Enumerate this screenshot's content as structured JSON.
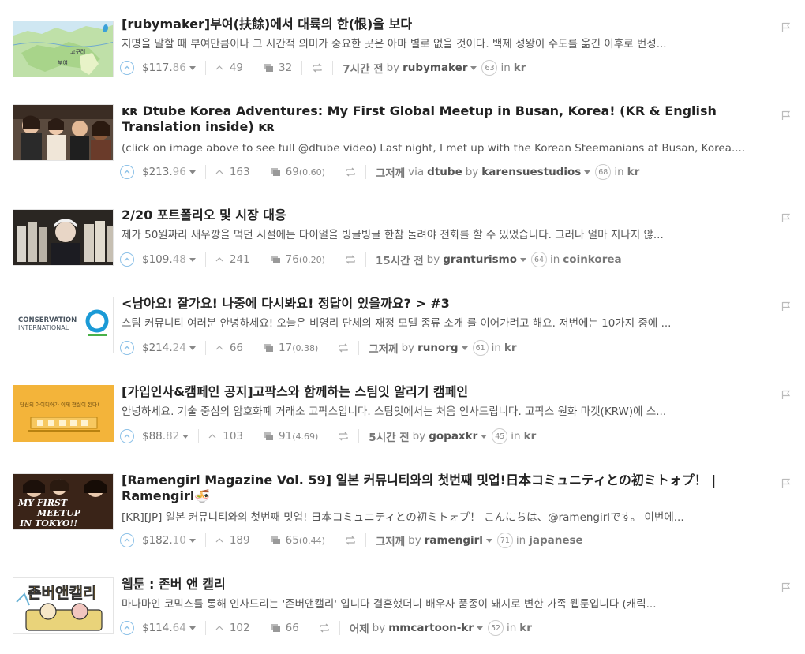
{
  "posts": [
    {
      "title": "[rubymaker]부여(扶餘)에서 대륙의 한(恨)을 보다",
      "summary": "지명을 말할 때 부여만큼이나 그 시간적 의미가 중요한 곳은 아마 별로 없을 것이다. 백제 성왕이 수도를 옮긴 이후로 번성...",
      "payout_int": "$117.",
      "payout_dec": "86",
      "votes": "49",
      "comments": "32",
      "comments_new": "",
      "time": "7시간 전",
      "app": "",
      "author": "rubymaker",
      "reputation": "63",
      "category": "kr",
      "thumb_labels": [
        "고구려",
        "부여"
      ]
    },
    {
      "title": "ᴋʀ Dtube Korea Adventures: My First Global Meetup in Busan, Korea! (KR & English Translation inside) ᴋʀ",
      "summary": "(click on image above to see full @dtube video) Last night, I met up with the Korean Steemanians at Busan, Korea....",
      "payout_int": "$213.",
      "payout_dec": "96",
      "votes": "163",
      "comments": "69",
      "comments_new": "(0.60)",
      "time": "그저께",
      "app": "dtube",
      "author": "karensuestudios",
      "reputation": "68",
      "category": "kr"
    },
    {
      "title": "2/20 포트폴리오 및 시장 대응",
      "summary": "제가 50원짜리 새우깡을 먹던 시절에는 다이얼을 빙글빙글 한참 돌려야 전화를 할 수 있었습니다. 그러나 얼마 지나지 않...",
      "payout_int": "$109.",
      "payout_dec": "48",
      "votes": "241",
      "comments": "76",
      "comments_new": "(0.20)",
      "time": "15시간 전",
      "app": "",
      "author": "granturismo",
      "reputation": "64",
      "category": "coinkorea"
    },
    {
      "title": "<남아요! 잘가요! 나중에 다시봐요! 정답이 있을까요? > #3",
      "summary": "스팀 커뮤니티 여러분 안녕하세요! 오늘은 비영리 단체의 재정 모델 종류 소개 를 이어가려고 해요. 저번에는 10가지 중에 ...",
      "payout_int": "$214.",
      "payout_dec": "24",
      "votes": "66",
      "comments": "17",
      "comments_new": "(0.38)",
      "time": "그저께",
      "app": "",
      "author": "runorg",
      "reputation": "61",
      "category": "kr",
      "thumb_labels": [
        "CONSERVATION",
        "INTERNATIONAL"
      ]
    },
    {
      "title": "[가입인사&캠페인 공지]고팍스와 함께하는 스팀잇 알리기 캠페인",
      "summary": "안녕하세요. 기술 중심의 암호화폐 거래소 고팍스입니다. 스팀잇에서는 처음 인사드립니다. 고팍스 원화 마켓(KRW)에 스...",
      "payout_int": "$88.",
      "payout_dec": "82",
      "votes": "103",
      "comments": "91",
      "comments_new": "(4.69)",
      "time": "5시간 전",
      "app": "",
      "author": "gopaxkr",
      "reputation": "45",
      "category": "kr",
      "thumb_labels": [
        "당신의 아이디어가 이제 현실이 된다!"
      ]
    },
    {
      "title": "[Ramengirl Magazine Vol. 59] 일본 커뮤니티와의 첫번째 밋업!日本コミュニティとの初ミトォプ！ | Ramengirl🍜",
      "summary": "[KR][JP] 일본 커뮤니티와의 첫번째 밋업! 日本コミュニティとの初ミトォプ！ こんにちは、@ramengirlです。 이번에...",
      "payout_int": "$182.",
      "payout_dec": "10",
      "votes": "189",
      "comments": "65",
      "comments_new": "(0.44)",
      "time": "그저께",
      "app": "",
      "author": "ramengirl",
      "reputation": "71",
      "category": "japanese",
      "thumb_labels": [
        "MY FIRST",
        "MEETUP",
        "IN TOKYO!!"
      ]
    },
    {
      "title": "웹툰 : 존버 앤 캘리",
      "summary": "마나마인 코믹스를 통해 인사드리는 '존버앤캘리' 입니다 결혼했더니 배우자 품종이 돼지로 변한 가족 웹툰입니다 (캐릭...",
      "payout_int": "$114.",
      "payout_dec": "64",
      "votes": "102",
      "comments": "66",
      "comments_new": "",
      "time": "어제",
      "app": "",
      "author": "mmcartoon-kr",
      "reputation": "52",
      "category": "kr",
      "thumb_labels": [
        "존버앤캘리"
      ]
    }
  ],
  "labels": {
    "by": "by",
    "in": "in",
    "via": "via"
  },
  "icons": {
    "upvote": "upvote-circle-icon",
    "votes": "chevron-up-icon",
    "comments": "comments-icon",
    "resteem": "resteem-icon",
    "flag": "flag-icon",
    "payout_dropdown": "caret-down-icon"
  },
  "colors": {
    "upvote": "#8ec2e8",
    "text": "#333333",
    "muted": "#888888"
  }
}
